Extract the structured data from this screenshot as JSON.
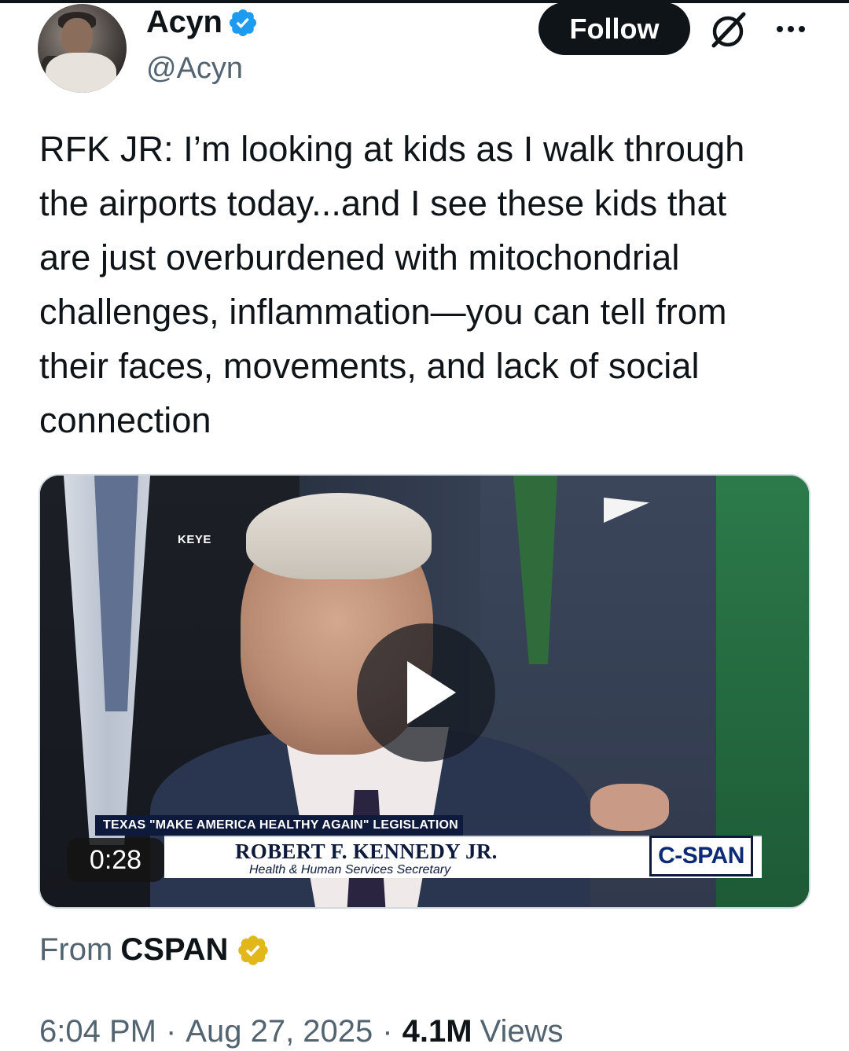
{
  "author": {
    "display_name": "Acyn",
    "handle": "@Acyn",
    "verified_color": "#1d9bf0"
  },
  "header": {
    "follow_label": "Follow",
    "icons": [
      "verified-badge-icon",
      "grok-icon",
      "more-icon"
    ]
  },
  "tweet": {
    "text": "RFK JR: I’m looking at kids as I walk through\nthe airports today...and I see these kids that\nare just overburdened with mitochondrial\nchallenges, inflammation—you can tell from\ntheir faces, movements, and lack of social\nconnection"
  },
  "video": {
    "station_bug": "KEYE",
    "lower_third_banner": "TEXAS \"MAKE AMERICA HEALTHY AGAIN\" LEGISLATION",
    "speaker_name": "ROBERT F. KENNEDY JR.",
    "speaker_title": "Health & Human Services Secretary",
    "network_logo": "C-SPAN",
    "duration": "0:28"
  },
  "attribution": {
    "from_label": "From",
    "source": "CSPAN",
    "badge_color": "#e2b719"
  },
  "meta": {
    "time": "6:04 PM",
    "separator": "·",
    "date": "Aug 27, 2025",
    "views_count": "4.1M",
    "views_label": "Views"
  }
}
